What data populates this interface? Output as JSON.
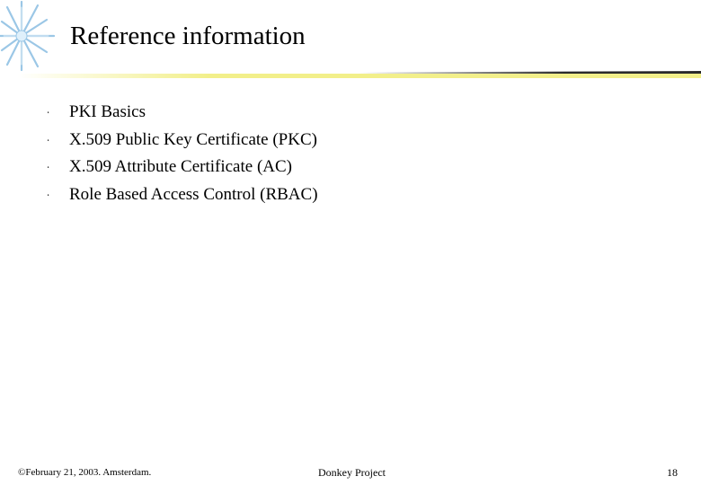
{
  "slide": {
    "title": "Reference information",
    "bullets": [
      "PKI Basics",
      "X.509 Public Key Certificate (PKC)",
      "X.509 Attribute Certificate (AC)",
      "Role Based Access Control (RBAC)"
    ],
    "bullet_glyph": "∙",
    "bullet_icon": "circle-bullet-icon"
  },
  "footer": {
    "left": "©February 21, 2003. Amsterdam.",
    "center": "Donkey Project",
    "page_number": "18"
  },
  "colors": {
    "accent_yellow": "#f2ef8a",
    "rule_dark": "#2a2a2a",
    "star_blue": "#9bc7e6"
  }
}
